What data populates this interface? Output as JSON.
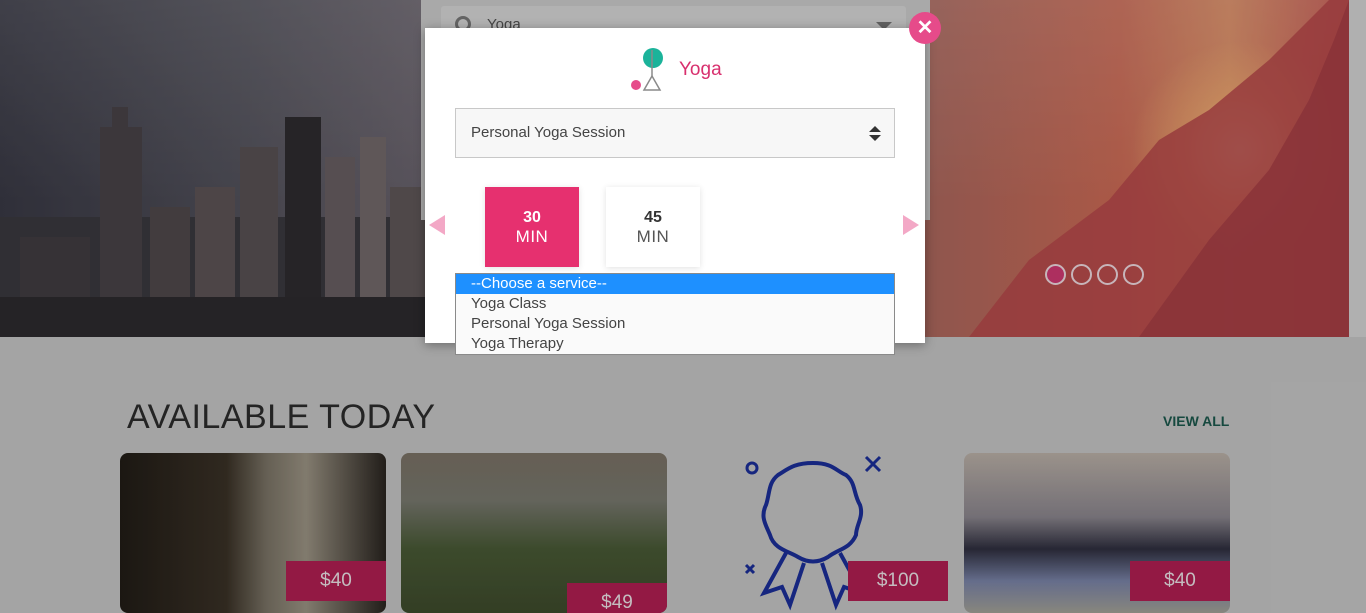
{
  "search": {
    "value": "Yoga"
  },
  "modal": {
    "category_title": "Yoga",
    "service_select_value": "Personal Yoga Session",
    "durations": [
      {
        "number": "30",
        "unit": "MIN",
        "selected": true
      },
      {
        "number": "45",
        "unit": "MIN",
        "selected": false
      }
    ],
    "dropdown_options": [
      "--Choose a service--",
      "Yoga Class",
      "Personal Yoga Session",
      "Yoga Therapy"
    ],
    "dropdown_selected_index": 0
  },
  "hero": {
    "slides_total": 4,
    "active_slide": 1
  },
  "section": {
    "title": "AVAILABLE TODAY",
    "view_all_label": "VIEW ALL"
  },
  "cards": [
    {
      "price": "$40"
    },
    {
      "price": "$49"
    },
    {
      "price": "$100"
    },
    {
      "price": "$40"
    }
  ],
  "colors": {
    "accent": "#e6306f",
    "price_bg": "#b41f53",
    "link": "#1c5a4e",
    "highlight": "#1e90ff"
  }
}
